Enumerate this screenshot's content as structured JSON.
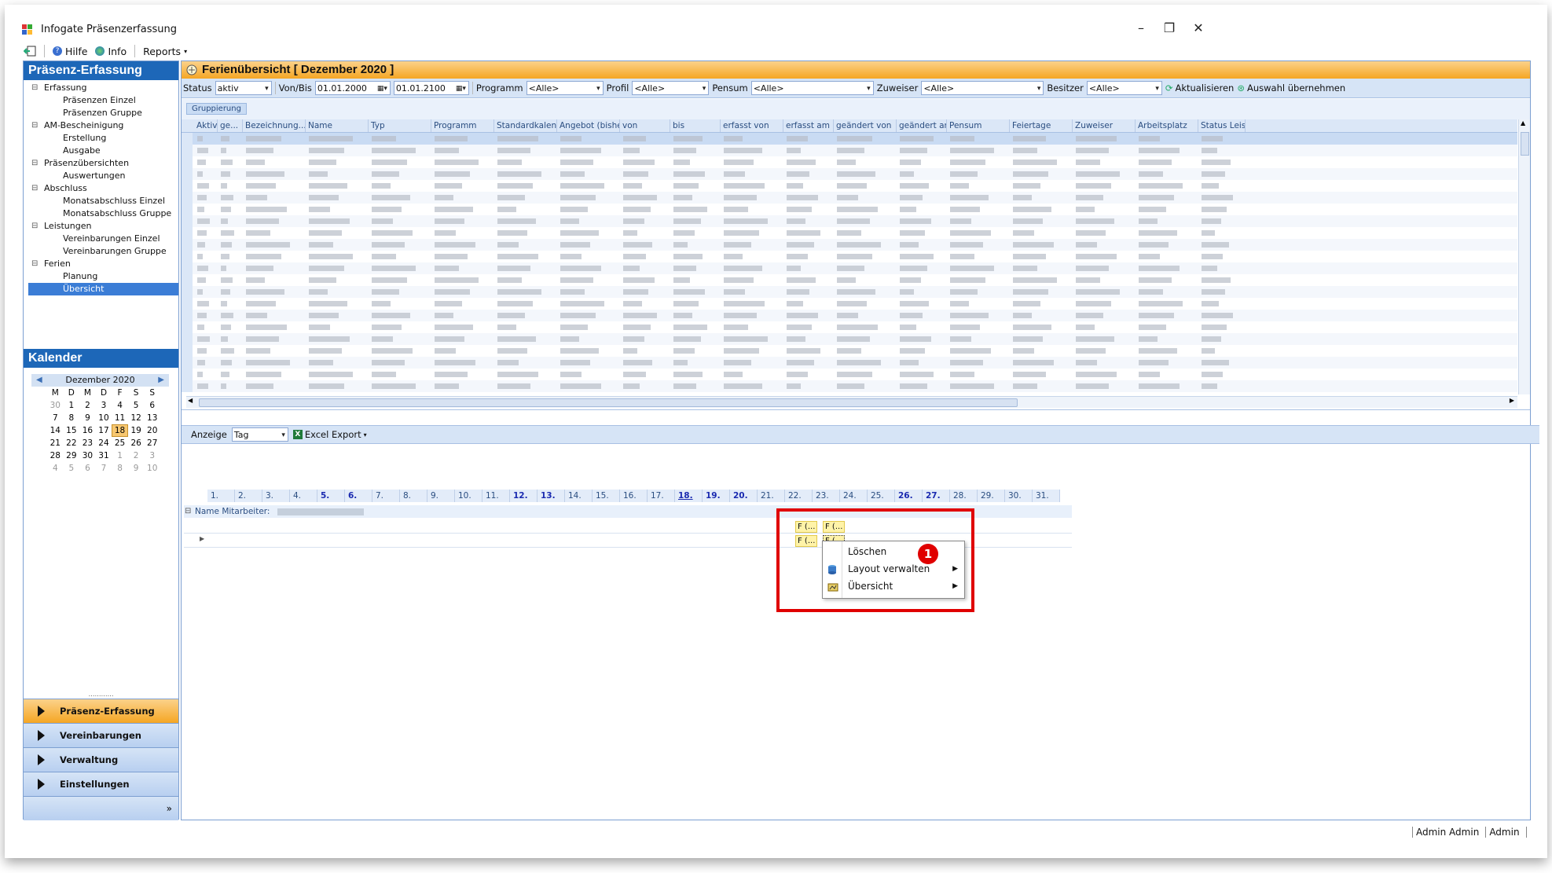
{
  "window": {
    "title": "Infogate Präsenzerfassung",
    "min": "–",
    "max": "❐",
    "close": "✕"
  },
  "menu": {
    "help": "Hilfe",
    "info": "Info",
    "reports": "Reports"
  },
  "nav": {
    "title": "Präsenz-Erfassung",
    "tree": [
      {
        "label": "Erfassung",
        "type": "grp"
      },
      {
        "label": "Präsenzen Einzel",
        "type": "leaf"
      },
      {
        "label": "Präsenzen Gruppe",
        "type": "leaf"
      },
      {
        "label": "AM-Bescheinigung",
        "type": "grp"
      },
      {
        "label": "Erstellung",
        "type": "leaf"
      },
      {
        "label": "Ausgabe",
        "type": "leaf"
      },
      {
        "label": "Präsenzübersichten",
        "type": "grp"
      },
      {
        "label": "Auswertungen",
        "type": "leaf"
      },
      {
        "label": "Abschluss",
        "type": "grp"
      },
      {
        "label": "Monatsabschluss Einzel",
        "type": "leaf"
      },
      {
        "label": "Monatsabschluss Gruppe",
        "type": "leaf"
      },
      {
        "label": "Leistungen",
        "type": "grp"
      },
      {
        "label": "Vereinbarungen Einzel",
        "type": "leaf"
      },
      {
        "label": "Vereinbarungen Gruppe",
        "type": "leaf"
      },
      {
        "label": "Ferien",
        "type": "grp"
      },
      {
        "label": "Planung",
        "type": "leaf"
      },
      {
        "label": "Übersicht",
        "type": "leaf",
        "selected": true
      }
    ],
    "calendar_title": "Kalender",
    "month": "Dezember 2020",
    "weekdays": [
      "M",
      "D",
      "M",
      "D",
      "F",
      "S",
      "S"
    ],
    "weeks": [
      [
        "30",
        "1",
        "2",
        "3",
        "4",
        "5",
        "6"
      ],
      [
        "7",
        "8",
        "9",
        "10",
        "11",
        "12",
        "13"
      ],
      [
        "14",
        "15",
        "16",
        "17",
        "18",
        "19",
        "20"
      ],
      [
        "21",
        "22",
        "23",
        "24",
        "25",
        "26",
        "27"
      ],
      [
        "28",
        "29",
        "30",
        "31",
        "1",
        "2",
        "3"
      ],
      [
        "4",
        "5",
        "6",
        "7",
        "8",
        "9",
        "10"
      ]
    ],
    "today": "18",
    "buttons": [
      "Präsenz-Erfassung",
      "Vereinbarungen",
      "Verwaltung",
      "Einstellungen"
    ],
    "more": "»"
  },
  "main": {
    "title": "Ferienübersicht",
    "period": "[ Dezember 2020 ]",
    "filters": {
      "status_label": "Status",
      "status_value": "aktiv",
      "vonbis_label": "Von/Bis",
      "von": "01.01.2000",
      "bis": "01.01.2100",
      "programm_label": "Programm",
      "programm_value": "<Alle>",
      "profil_label": "Profil",
      "profil_value": "<Alle>",
      "pensum_label": "Pensum",
      "pensum_value": "<Alle>",
      "zuweiser_label": "Zuweiser",
      "zuweiser_value": "<Alle>",
      "besitzer_label": "Besitzer",
      "besitzer_value": "<Alle>",
      "refresh": "Aktualisieren",
      "apply": "Auswahl übernehmen"
    },
    "group_button": "Gruppierung",
    "columns": [
      "Aktiv",
      "ge...",
      "Bezeichnung...",
      "Name",
      "Typ",
      "Programm",
      "Standardkalender",
      "Angebot (bisher)",
      "von",
      "bis",
      "erfasst von",
      "erfasst am",
      "geändert von",
      "geändert am",
      "Pensum",
      "Feiertage",
      "Zuweiser",
      "Arbeitsplatz",
      "Status Leistung"
    ],
    "row_count": 22
  },
  "schedule": {
    "display_label": "Anzeige",
    "display_value": "Tag",
    "excel": "Excel Export",
    "days": [
      "1.",
      "2.",
      "3.",
      "4.",
      "5.",
      "6.",
      "7.",
      "8.",
      "9.",
      "10.",
      "11.",
      "12.",
      "13.",
      "14.",
      "15.",
      "16.",
      "17.",
      "18.",
      "19.",
      "20.",
      "21.",
      "22.",
      "23.",
      "24.",
      "25.",
      "26.",
      "27.",
      "28.",
      "29.",
      "30.",
      "31."
    ],
    "bold_days": [
      "5.",
      "6.",
      "12.",
      "13.",
      "18.",
      "19.",
      "20.",
      "26.",
      "27."
    ],
    "underline_days": [
      "18."
    ],
    "employee_label": "Name Mitarbeiter:",
    "chip1": "F (...",
    "chip2": "F (...",
    "chip3": "F (...",
    "chip4": "F (..."
  },
  "context_menu": {
    "items": [
      "Löschen",
      "Layout verwalten",
      "Übersicht"
    ],
    "badge": "1"
  },
  "status": {
    "user1": "Admin Admin",
    "user2": "Admin"
  }
}
